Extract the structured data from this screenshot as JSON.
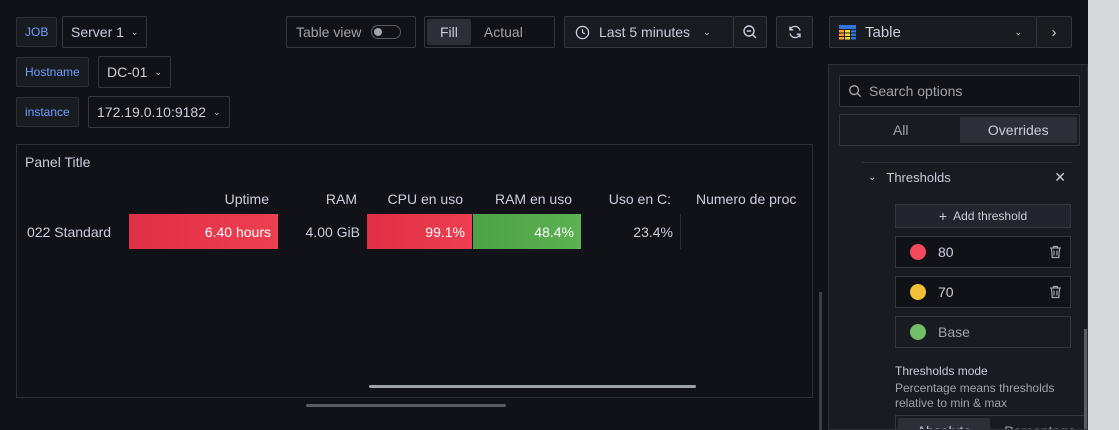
{
  "variables": {
    "job_label": "JOB",
    "job_value": "Server 1",
    "hostname_label": "Hostname",
    "hostname_value": "DC-01",
    "instance_label": "instance",
    "instance_value": "172.19.0.10:9182"
  },
  "toolbar": {
    "table_view_label": "Table view",
    "fill_label": "Fill",
    "actual_label": "Actual",
    "time_range": "Last 5 minutes",
    "viz_label": "Table"
  },
  "panel": {
    "title": "Panel Title",
    "columns": [
      "Uptime",
      "RAM",
      "CPU en uso",
      "RAM en uso",
      "Uso en C:",
      "Numero de proc"
    ],
    "row": {
      "name": "022 Standard",
      "uptime": "6.40 hours",
      "ram": "4.00 GiB",
      "cpu": "99.1%",
      "ram_used": "48.4%",
      "disk": "23.4%",
      "procs": ""
    }
  },
  "options": {
    "search_placeholder": "Search options",
    "tab_all": "All",
    "tab_overrides": "Overrides",
    "section_title": "Thresholds",
    "add_threshold_label": "Add threshold",
    "thresholds": [
      {
        "value": "80",
        "color": "#f2495c"
      },
      {
        "value": "70",
        "color": "#fade2a"
      },
      {
        "value": "Base",
        "color": "#73bf69"
      }
    ],
    "mode_title": "Thresholds mode",
    "mode_desc_1": "Percentage means thresholds",
    "mode_desc_2": "relative to min & max",
    "mode_absolute": "Absolute",
    "mode_percentage": "Percentage"
  },
  "colors": {
    "red": "#e02f44",
    "green": "#56a64b",
    "accent": "#6e9fff"
  }
}
